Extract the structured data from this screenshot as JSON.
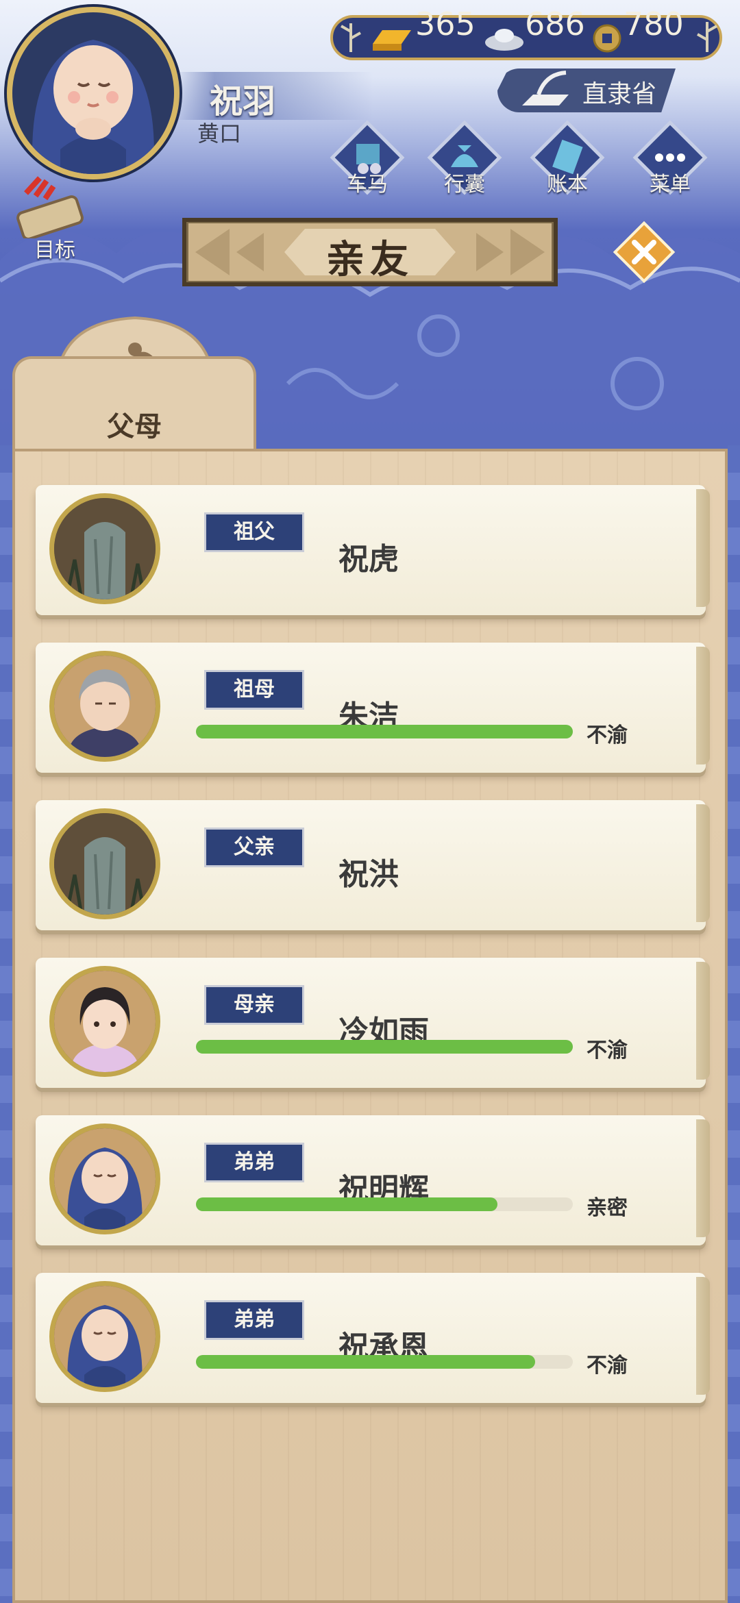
{
  "player": {
    "name": "祝羽",
    "sub_label": "黄口"
  },
  "currency": {
    "gold": "365",
    "silver": "686",
    "coin": "780"
  },
  "location": "直隶省",
  "menu": [
    {
      "label": "车马",
      "icon": "carriage-icon"
    },
    {
      "label": "行囊",
      "icon": "bundle-icon"
    },
    {
      "label": "账本",
      "icon": "ledger-icon"
    },
    {
      "label": "菜单",
      "icon": "more-icon"
    }
  ],
  "goal": {
    "label": "目标",
    "icon": "scroll-icon"
  },
  "title": "亲友",
  "tab": {
    "label": "父母"
  },
  "members": [
    {
      "relation": "祖父",
      "name": "祝虎",
      "status": "",
      "affinity": null,
      "portrait": "tombstone-portrait"
    },
    {
      "relation": "祖母",
      "name": "朱洁",
      "status": "不渝",
      "affinity": 1.0,
      "portrait": "grandmother-portrait"
    },
    {
      "relation": "父亲",
      "name": "祝洪",
      "status": "",
      "affinity": null,
      "portrait": "tombstone-portrait"
    },
    {
      "relation": "母亲",
      "name": "冷如雨",
      "status": "不渝",
      "affinity": 1.0,
      "portrait": "mother-portrait"
    },
    {
      "relation": "弟弟",
      "name": "祝明辉",
      "status": "亲密",
      "affinity": 0.8,
      "portrait": "baby-portrait"
    },
    {
      "relation": "弟弟",
      "name": "祝承恩",
      "status": "不渝",
      "affinity": 0.9,
      "portrait": "baby-portrait"
    }
  ],
  "colors": {
    "accent_bar": "#6cbe45",
    "badge_bg": "#2d4178",
    "gold_border": "#c9a658"
  }
}
